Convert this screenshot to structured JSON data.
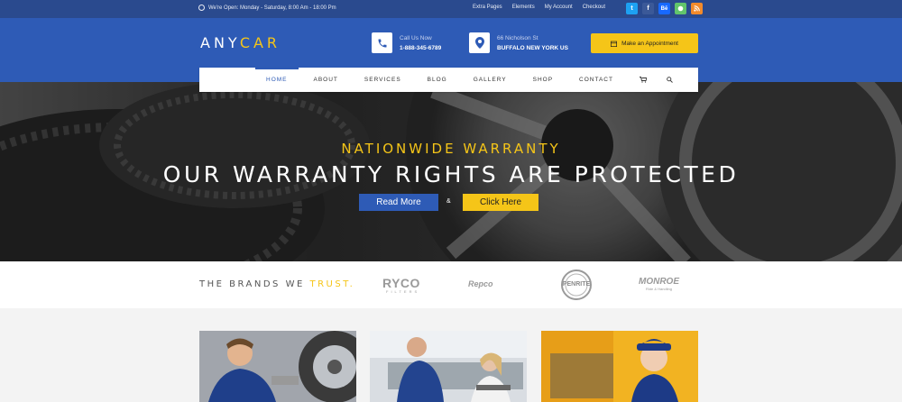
{
  "topbar": {
    "hours": "We're Open: Monday - Saturday, 8:00 Am - 18:00 Pm",
    "links": [
      "Extra Pages",
      "Elements",
      "My Account",
      "Checkout"
    ],
    "socials": [
      {
        "name": "twitter-icon",
        "glyph": "t",
        "color": "#1da1f2"
      },
      {
        "name": "facebook-icon",
        "glyph": "f",
        "color": "#3b5998"
      },
      {
        "name": "behance-icon",
        "glyph": "Bē",
        "color": "#1769ff"
      },
      {
        "name": "chat-icon",
        "glyph": "●",
        "color": "#62c46b"
      },
      {
        "name": "rss-icon",
        "glyph": "◉",
        "color": "#f28a2b"
      }
    ]
  },
  "header": {
    "logo_any": "ANY",
    "logo_car": "CAR",
    "phone_label": "Call Us Now",
    "phone_number": "1-888-345-6789",
    "address_line1": "66 Nicholson St",
    "address_line2": "BUFFALO NEW YORK US",
    "appointment_label": "Make an Appointment"
  },
  "nav": {
    "items": [
      "HOME",
      "ABOUT",
      "SERVICES",
      "BLOG",
      "GALLERY",
      "SHOP",
      "CONTACT"
    ]
  },
  "hero": {
    "subtitle": "NATIONWIDE WARRANTY",
    "title": "OUR WARRANTY RIGHTS ARE PROTECTED",
    "read_more": "Read More",
    "amp": "&",
    "click_here": "Click Here"
  },
  "brands": {
    "label_a": "THE BRANDS WE ",
    "label_b": "TRUST.",
    "ryco": "RYCO",
    "ryco_sub": "FILTERS",
    "repco": "Repco",
    "penrite": "PENRITE",
    "monroe": "MONROE",
    "monroe_sub": "Ride & Handling"
  },
  "colors": {
    "primary": "#2e5bb6",
    "topbar": "#2a4a8e",
    "accent": "#f5c518"
  }
}
